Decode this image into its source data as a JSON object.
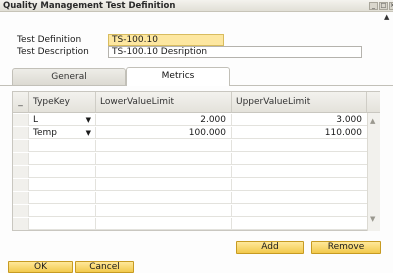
{
  "window": {
    "title": "Quality Management Test Definition",
    "controls": {
      "minimize": "_",
      "maximize": "□",
      "close": "×"
    },
    "side_mark": "▲"
  },
  "header": {
    "test_definition_label": "Test Definition",
    "test_definition_value": "TS-100.10",
    "test_description_label": "Test Description",
    "test_description_value": "TS-100.10 Desription"
  },
  "tabs": [
    {
      "label": "General",
      "active": false
    },
    {
      "label": "Metrics",
      "active": true
    }
  ],
  "grid": {
    "columns": [
      "_",
      "TypeKey",
      "LowerValueLimit",
      "UpperValueLimit"
    ],
    "rows": [
      {
        "typekey": "L",
        "lower": "2.000",
        "upper": "3.000"
      },
      {
        "typekey": "Temp",
        "lower": "100.000",
        "upper": "110.000"
      }
    ],
    "empty_rows": 7,
    "dropdown_arrow": "▼",
    "scroll_up": "▲",
    "scroll_down": "▼"
  },
  "buttons": {
    "add": "Add",
    "remove": "Remove",
    "ok": "OK",
    "cancel": "Cancel"
  },
  "colors": {
    "active_field": "#fde7a0",
    "button_yellow": "#f2c94c"
  }
}
